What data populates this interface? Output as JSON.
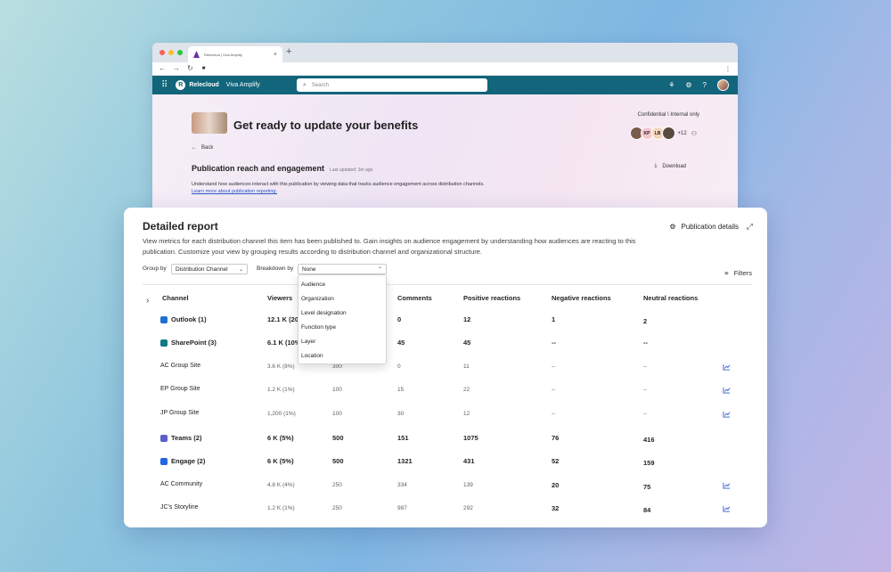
{
  "browser": {
    "tab_title": "Relecloud | Viva Amplify",
    "new_tab": "+",
    "back_icon": "←",
    "forward_icon": "→",
    "reload_icon": "↻",
    "lock_icon": "🔒",
    "menu_icon": "⋮"
  },
  "appbar": {
    "waffle_icon": "⠿",
    "brand": "Relecloud",
    "app_name": "Viva Amplify",
    "search_placeholder": "Search",
    "search_icon": "⌕",
    "icons": [
      "copilot-icon",
      "settings-icon",
      "help-icon"
    ],
    "settings_glyph": "⚙",
    "help_glyph": "?",
    "apps_glyph": "⚘"
  },
  "publication": {
    "title": "Get ready to update your benefits",
    "confidentiality": "Confidential \\ Internal only",
    "back_label": "Back",
    "section_title": "Publication reach and engagement",
    "last_updated": "Last updated: 3m ago",
    "download_label": "Download",
    "description": "Understand how audiences interact with this publication by viewing data that tracks audience engagement across distribution channels.",
    "learn_more": "Learn more about publication reporting.",
    "facepile": [
      {
        "initials": "",
        "bg": "#7a5a4a"
      },
      {
        "initials": "KP",
        "bg": "#f4c7d0"
      },
      {
        "initials": "LB",
        "bg": "#f6d4b8"
      },
      {
        "initials": "",
        "bg": "#5a4a40"
      }
    ],
    "facepile_more": "+12"
  },
  "report": {
    "title": "Detailed report",
    "publication_details": "Publication details",
    "description": "View metrics for each distribution channel this item has been published to. Gain insights on audience engagement by understanding how audiences are reacting to this publication. Customize your view by grouping results according to distribution channel and organizational structure.",
    "group_by_label": "Group by",
    "group_by_value": "Distribution Channel",
    "breakdown_by_label": "Breakdown by",
    "breakdown_by_value": "None",
    "filters_label": "Filters",
    "columns": {
      "channel": "Channel",
      "viewers": "Viewers",
      "comments": "Comments",
      "positive": "Positive reactions",
      "negative": "Negative reactions",
      "neutral": "Neutral reactions"
    },
    "breakdown_options": [
      "Audience",
      "Organization",
      "Level designation",
      "Function type",
      "Layer",
      "Location"
    ],
    "rows": [
      {
        "channel": "Outlook (1)",
        "viewers": "12.1 K (20",
        "col3": "",
        "comments": "0",
        "positive": "12",
        "negative": "1",
        "neutral": "2",
        "level": "group",
        "icon": "#1f6fd1",
        "trend": false
      },
      {
        "channel": "SharePoint (3)",
        "viewers": "6.1 K (10%",
        "col3": "",
        "comments": "45",
        "positive": "45",
        "negative": "--",
        "neutral": "--",
        "level": "group",
        "icon": "#0e7a85",
        "trend": false
      },
      {
        "channel": "AC Group Site",
        "viewers": "3.6 K (8%)",
        "col3": "300",
        "comments": "0",
        "positive": "11",
        "negative": "--",
        "neutral": "--",
        "level": "sub",
        "icon": "",
        "trend": true
      },
      {
        "channel": "EP Group Site",
        "viewers": "1.2 K (1%)",
        "col3": "100",
        "comments": "15",
        "positive": "22",
        "negative": "--",
        "neutral": "--",
        "level": "sub",
        "icon": "",
        "trend": true
      },
      {
        "channel": "JP Group Site",
        "viewers": "1,200 (1%)",
        "col3": "100",
        "comments": "30",
        "positive": "12",
        "negative": "--",
        "neutral": "--",
        "level": "sub",
        "icon": "",
        "trend": true
      },
      {
        "channel": "Teams (2)",
        "viewers": "6 K (5%)",
        "col3": "500",
        "comments": "151",
        "positive": "1075",
        "negative": "76",
        "neutral": "416",
        "level": "group",
        "icon": "#5b5fc7",
        "trend": false
      },
      {
        "channel": "Engage (2)",
        "viewers": "6 K (5%)",
        "col3": "500",
        "comments": "1321",
        "positive": "431",
        "negative": "52",
        "neutral": "159",
        "level": "group",
        "icon": "#2266e3",
        "trend": false
      },
      {
        "channel": "AC Community",
        "viewers": "4.8 K (4%)",
        "col3": "250",
        "comments": "334",
        "positive": "139",
        "negative": "20",
        "neutral": "75",
        "level": "sub",
        "icon": "",
        "trend": true
      },
      {
        "channel": "JC's Storyline",
        "viewers": "1.2 K (1%)",
        "col3": "250",
        "comments": "987",
        "positive": "292",
        "negative": "32",
        "neutral": "84",
        "level": "sub",
        "icon": "",
        "trend": true
      }
    ]
  },
  "colors": {
    "appbar": "#12657a",
    "link": "#2b58c8",
    "trend_icon": "#2b58c8"
  }
}
